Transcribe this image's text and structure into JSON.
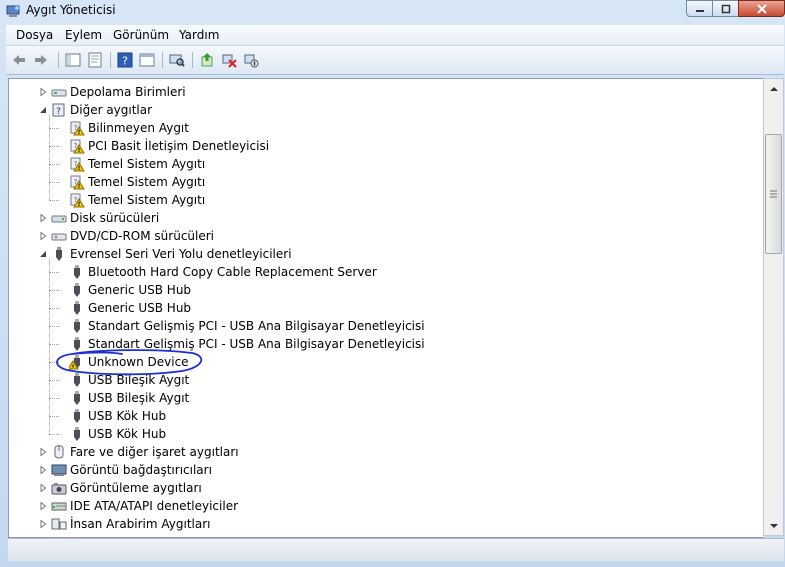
{
  "window": {
    "title": "Aygıt Yöneticisi"
  },
  "menu": {
    "items": [
      "Dosya",
      "Eylem",
      "Görünüm",
      "Yardım"
    ]
  },
  "toolbar": {
    "buttons": [
      "back-icon",
      "forward-icon",
      "view-tree-icon",
      "properties-icon",
      "help-icon",
      "view-list-icon",
      "scan-icon",
      "update-driver-icon",
      "uninstall-icon",
      "disable-icon"
    ]
  },
  "tree": {
    "rows": [
      {
        "label": "Depolama Birimleri",
        "level": 0,
        "expander": "collapsed",
        "icon": "storage-icon"
      },
      {
        "label": "Diğer aygıtlar",
        "level": 0,
        "expander": "expanded",
        "icon": "other-devices-icon"
      },
      {
        "label": "Bilinmeyen Aygıt",
        "level": 1,
        "expander": "none",
        "icon": "warning-device-icon"
      },
      {
        "label": "PCI Basit İletişim Denetleyicisi",
        "level": 1,
        "expander": "none",
        "icon": "warning-device-icon"
      },
      {
        "label": "Temel Sistem Aygıtı",
        "level": 1,
        "expander": "none",
        "icon": "warning-device-icon"
      },
      {
        "label": "Temel Sistem Aygıtı",
        "level": 1,
        "expander": "none",
        "icon": "warning-device-icon"
      },
      {
        "label": "Temel Sistem Aygıtı",
        "level": 1,
        "expander": "none",
        "icon": "warning-device-icon"
      },
      {
        "label": "Disk sürücüleri",
        "level": 0,
        "expander": "collapsed",
        "icon": "disk-icon"
      },
      {
        "label": "DVD/CD-ROM sürücüleri",
        "level": 0,
        "expander": "collapsed",
        "icon": "dvd-icon"
      },
      {
        "label": "Evrensel Seri Veri Yolu denetleyicileri",
        "level": 0,
        "expander": "expanded",
        "icon": "usb-icon"
      },
      {
        "label": "Bluetooth Hard Copy Cable Replacement Server",
        "level": 1,
        "expander": "none",
        "icon": "usb-plug-icon"
      },
      {
        "label": "Generic USB Hub",
        "level": 1,
        "expander": "none",
        "icon": "usb-plug-icon"
      },
      {
        "label": "Generic USB Hub",
        "level": 1,
        "expander": "none",
        "icon": "usb-plug-icon"
      },
      {
        "label": "Standart Gelişmiş PCI - USB Ana Bilgisayar Denetleyicisi",
        "level": 1,
        "expander": "none",
        "icon": "usb-plug-icon"
      },
      {
        "label": "Standart Gelişmiş PCI - USB Ana Bilgisayar Denetleyicisi",
        "level": 1,
        "expander": "none",
        "icon": "usb-plug-icon"
      },
      {
        "label": "Unknown Device",
        "level": 1,
        "expander": "none",
        "icon": "usb-warning-icon"
      },
      {
        "label": "USB Bileşik Aygıt",
        "level": 1,
        "expander": "none",
        "icon": "usb-plug-icon"
      },
      {
        "label": "USB Bileşik Aygıt",
        "level": 1,
        "expander": "none",
        "icon": "usb-plug-icon"
      },
      {
        "label": "USB Kök Hub",
        "level": 1,
        "expander": "none",
        "icon": "usb-plug-icon"
      },
      {
        "label": "USB Kök Hub",
        "level": 1,
        "expander": "none",
        "icon": "usb-plug-icon"
      },
      {
        "label": "Fare ve diğer işaret aygıtları",
        "level": 0,
        "expander": "collapsed",
        "icon": "mouse-icon"
      },
      {
        "label": "Görüntü bağdaştırıcıları",
        "level": 0,
        "expander": "collapsed",
        "icon": "display-adapter-icon"
      },
      {
        "label": "Görüntüleme aygıtları",
        "level": 0,
        "expander": "collapsed",
        "icon": "imaging-icon"
      },
      {
        "label": "IDE ATA/ATAPI denetleyiciler",
        "level": 0,
        "expander": "collapsed",
        "icon": "ide-icon"
      },
      {
        "label": "İnsan Arabirim Aygıtları",
        "level": 0,
        "expander": "collapsed",
        "icon": "hid-icon"
      }
    ]
  },
  "colors": {
    "annotation": "#1d2fd6",
    "warning": "#f2c400"
  }
}
